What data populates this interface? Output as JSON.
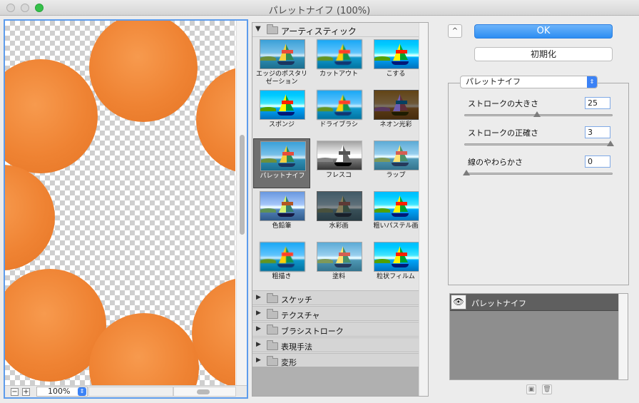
{
  "window": {
    "title": "パレットナイフ (100%)"
  },
  "preview": {
    "zoom": "100%",
    "zoom_out": "−",
    "zoom_in": "+"
  },
  "gallery": {
    "open_category": "アーティスティック",
    "filters": [
      {
        "label": "エッジのポスタリゼーション",
        "style": "normal"
      },
      {
        "label": "カットアウト",
        "style": "soft"
      },
      {
        "label": "こする",
        "style": "grain"
      },
      {
        "label": "スポンジ",
        "style": "grain"
      },
      {
        "label": "ドライブラシ",
        "style": "soft"
      },
      {
        "label": "ネオン光彩",
        "style": "neon"
      },
      {
        "label": "パレットナイフ",
        "style": "normal",
        "selected": true
      },
      {
        "label": "フレスコ",
        "style": "bw"
      },
      {
        "label": "ラップ",
        "style": "sketch"
      },
      {
        "label": "色鉛筆",
        "style": "pencil"
      },
      {
        "label": "水彩画",
        "style": "dark"
      },
      {
        "label": "粗いパステル画",
        "style": "grain"
      },
      {
        "label": "粗描き",
        "style": "soft"
      },
      {
        "label": "塗料",
        "style": "sketch"
      },
      {
        "label": "粒状フィルム",
        "style": "grain"
      }
    ],
    "closed_categories": [
      "スケッチ",
      "テクスチャ",
      "ブラシストローク",
      "表現手法",
      "変形"
    ]
  },
  "actions": {
    "ok": "OK",
    "reset": "初期化",
    "collapse": "^"
  },
  "settings": {
    "filter_select": "パレットナイフ",
    "params": [
      {
        "label": "ストロークの大きさ",
        "value": "25",
        "fraction": 0.49
      },
      {
        "label": "ストロークの正確さ",
        "value": "3",
        "fraction": 1.0
      },
      {
        "label": "線のやわらかさ",
        "value": "0",
        "fraction": 0.0
      }
    ]
  },
  "layers": {
    "items": [
      {
        "label": "パレットナイフ"
      }
    ]
  }
}
